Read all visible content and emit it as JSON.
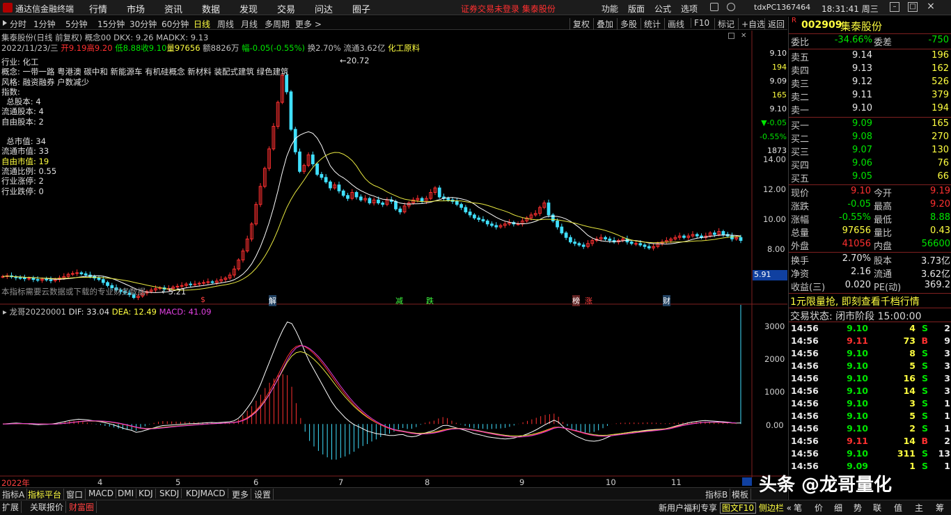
{
  "menubar": {
    "app_title": "通达信金融终端",
    "menus": [
      "行情",
      "市场",
      "资讯",
      "数据",
      "发现",
      "交易",
      "问达",
      "圈子"
    ],
    "warning": "证券交易未登录  集泰股份",
    "right_menus": [
      "功能",
      "版面",
      "公式",
      "选项"
    ],
    "account": "tdxPC1367464",
    "clock": "18:31:41 周三"
  },
  "periods": [
    "分时",
    "1分钟",
    "5分钟",
    "15分钟",
    "30分钟",
    "60分钟",
    "日线",
    "周线",
    "月线",
    "多周期",
    "更多 >"
  ],
  "active_period": "日线",
  "tools": [
    "复权",
    "叠加",
    "多股",
    "统计",
    "画线",
    "F10",
    "标记",
    "+自选",
    "返回"
  ],
  "main": {
    "header1": "集泰股份(日线 前复权) ",
    "header1b": "概念00 DKX: 9.26 MADKX: 9.13",
    "date_line": "2022/11/23/三",
    "open": "开9.19",
    "high": "高9.20",
    "low": "低8.88",
    "close": "收9.10",
    "vol": "量97656",
    "amt": "额8826万",
    "chg": "幅-0.05(-0.55%)",
    "turn": "换2.70%",
    "float": "流通3.62亿",
    "sector": "化工原料",
    "info_lines": [
      "行业: 化工",
      "概念: 一带一路 粤港澳 碳中和 新能源车 有机硅概念 新材料 装配式建筑 绿色建筑",
      "风格: 融资融券 户数减少",
      "指数:",
      "  总股本: 4",
      "流通股本: 4",
      "自由股本: 2",
      "",
      "  总市值: 34",
      "流通市值: 33",
      "自由市值: 19",
      "流通比例: 0.55",
      "行业涨停: 2",
      "行业跌停: 0"
    ],
    "note": "本指标需要云数据或下载的专业财务数据",
    "high_mark": "20.72",
    "low_mark": "5.21",
    "event_marks": [
      "$",
      "解",
      "减",
      "跌",
      "榜",
      "涨",
      "财"
    ],
    "axis_labels": [
      "14.00",
      "12.00",
      "10.00",
      "8.00"
    ],
    "mini_quote": [
      "9.10",
      "194",
      "9.09",
      "165",
      "9.10",
      "▼-0.05",
      "-0.55%",
      "1873"
    ],
    "cursor_label": "5.91"
  },
  "main_chart_data": {
    "type": "candlestick",
    "ylim": [
      5.0,
      21.5
    ],
    "x": [
      "2022-03-10",
      "2022-03-11",
      "2022-03-14",
      "2022-03-15",
      "2022-03-16",
      "2022-03-17",
      "2022-03-18",
      "2022-03-21",
      "2022-03-22",
      "2022-03-23",
      "2022-03-24",
      "2022-03-25",
      "2022-03-28",
      "2022-03-29",
      "2022-03-30",
      "2022-03-31",
      "2022-04-01",
      "2022-04-06",
      "2022-04-07",
      "2022-04-08",
      "2022-04-11",
      "2022-04-12",
      "2022-04-13",
      "2022-04-14",
      "2022-04-15",
      "2022-04-18",
      "2022-04-19",
      "2022-04-20",
      "2022-04-21",
      "2022-04-22",
      "2022-04-25",
      "2022-04-26",
      "2022-04-27",
      "2022-04-28",
      "2022-04-29",
      "2022-05-05",
      "2022-05-06",
      "2022-05-09",
      "2022-05-10",
      "2022-05-11",
      "2022-05-12",
      "2022-05-13",
      "2022-05-16",
      "2022-05-17",
      "2022-05-18",
      "2022-05-19",
      "2022-05-20",
      "2022-05-23",
      "2022-05-24",
      "2022-05-25",
      "2022-05-26",
      "2022-05-27",
      "2022-05-30",
      "2022-05-31",
      "2022-06-01",
      "2022-06-02",
      "2022-06-06",
      "2022-06-07",
      "2022-06-08",
      "2022-06-09",
      "2022-06-10",
      "2022-06-13",
      "2022-06-14",
      "2022-06-15",
      "2022-06-16",
      "2022-06-17",
      "2022-06-20",
      "2022-06-21",
      "2022-06-22",
      "2022-06-23",
      "2022-06-24",
      "2022-06-27",
      "2022-06-28",
      "2022-06-29",
      "2022-06-30",
      "2022-07-01",
      "2022-07-04",
      "2022-07-05",
      "2022-07-06",
      "2022-07-07",
      "2022-07-08",
      "2022-07-11",
      "2022-07-12",
      "2022-07-13",
      "2022-07-14",
      "2022-07-15",
      "2022-07-18",
      "2022-07-19",
      "2022-07-20",
      "2022-07-21",
      "2022-07-22",
      "2022-07-25",
      "2022-07-26",
      "2022-07-27",
      "2022-07-28",
      "2022-07-29",
      "2022-08-01",
      "2022-08-02",
      "2022-08-03",
      "2022-08-04",
      "2022-08-05",
      "2022-08-08",
      "2022-08-09",
      "2022-08-10",
      "2022-08-11",
      "2022-08-12",
      "2022-08-15",
      "2022-08-16",
      "2022-08-17",
      "2022-08-18",
      "2022-08-19",
      "2022-08-22",
      "2022-08-23",
      "2022-08-24",
      "2022-08-25",
      "2022-08-26",
      "2022-08-29",
      "2022-08-30",
      "2022-08-31",
      "2022-09-01",
      "2022-09-02",
      "2022-09-05",
      "2022-09-06",
      "2022-09-07",
      "2022-09-08",
      "2022-09-09",
      "2022-09-13",
      "2022-09-14",
      "2022-09-15",
      "2022-09-16",
      "2022-09-19",
      "2022-09-20",
      "2022-09-21",
      "2022-09-22",
      "2022-09-23",
      "2022-09-26",
      "2022-09-27",
      "2022-09-28",
      "2022-09-29",
      "2022-09-30",
      "2022-10-10",
      "2022-10-11",
      "2022-10-12",
      "2022-10-13",
      "2022-10-14",
      "2022-10-17",
      "2022-10-18",
      "2022-10-19",
      "2022-10-20",
      "2022-10-21",
      "2022-10-24",
      "2022-10-25",
      "2022-10-26",
      "2022-10-27",
      "2022-10-28",
      "2022-10-31",
      "2022-11-01",
      "2022-11-02",
      "2022-11-03",
      "2022-11-04",
      "2022-11-07",
      "2022-11-08",
      "2022-11-09",
      "2022-11-10",
      "2022-11-11",
      "2022-11-14",
      "2022-11-15",
      "2022-11-16",
      "2022-11-17",
      "2022-11-18",
      "2022-11-21",
      "2022-11-22",
      "2022-11-23"
    ],
    "closes": [
      6.7,
      6.75,
      6.68,
      6.62,
      6.6,
      6.55,
      6.58,
      6.5,
      6.45,
      6.52,
      6.48,
      6.42,
      6.5,
      6.6,
      6.7,
      6.85,
      6.9,
      6.95,
      6.88,
      6.8,
      6.7,
      6.6,
      6.5,
      6.3,
      6.1,
      5.95,
      5.8,
      5.7,
      5.6,
      5.5,
      5.3,
      5.4,
      5.6,
      5.7,
      5.8,
      5.9,
      5.95,
      5.85,
      5.9,
      6.0,
      6.05,
      6.1,
      6.2,
      6.15,
      6.2,
      6.25,
      6.3,
      6.35,
      6.3,
      6.4,
      6.5,
      6.6,
      6.8,
      7.2,
      7.8,
      8.4,
      9.2,
      10.2,
      11.5,
      12.7,
      13.9,
      15.2,
      16.7,
      18.3,
      20.1,
      19.0,
      16.5,
      15.0,
      13.7,
      14.1,
      14.8,
      14.2,
      13.5,
      13.3,
      13.0,
      12.6,
      12.8,
      12.4,
      12.1,
      11.9,
      12.3,
      12.0,
      11.8,
      11.9,
      11.6,
      11.8,
      11.6,
      11.5,
      11.8,
      11.7,
      11.2,
      11.0,
      11.4,
      11.6,
      11.8,
      11.9,
      11.7,
      11.9,
      12.3,
      12.6,
      12.0,
      11.9,
      11.8,
      11.7,
      11.5,
      11.3,
      11.0,
      10.8,
      10.6,
      10.5,
      10.4,
      10.2,
      10.1,
      10.0,
      10.1,
      10.2,
      10.3,
      10.2,
      10.2,
      10.4,
      10.6,
      10.8,
      10.9,
      11.3,
      11.6,
      10.8,
      10.4,
      10.0,
      9.6,
      9.3,
      9.0,
      8.9,
      8.8,
      8.7,
      8.9,
      9.1,
      9.2,
      9.3,
      9.2,
      9.1,
      9.0,
      9.1,
      9.2,
      9.0,
      8.9,
      8.9,
      8.8,
      8.7,
      8.6,
      8.7,
      8.9,
      9.0,
      9.1,
      9.2,
      9.3,
      9.4,
      9.3,
      9.4,
      9.5,
      9.4,
      9.3,
      9.4,
      9.6,
      9.5,
      9.7,
      9.5,
      9.4,
      9.2,
      9.3,
      9.1
    ]
  },
  "macd": {
    "header": "龙哥20220001 ",
    "dif": "DIF: 33.04",
    "dea": "DEA: 12.49",
    "macd": "MACD: 41.09",
    "axis_labels": [
      "3000",
      "2000",
      "1000",
      "0.00"
    ],
    "x_labels": [
      "2022年",
      "4",
      "5",
      "6",
      "7",
      "8",
      "9",
      "10",
      "11"
    ]
  },
  "macd_chart_data": {
    "type": "line",
    "ylim": [
      -1500,
      3300
    ],
    "dif": [
      0,
      10,
      20,
      30,
      20,
      10,
      0,
      -10,
      -20,
      -15,
      -10,
      0,
      20,
      50,
      80,
      110,
      130,
      150,
      140,
      130,
      110,
      90,
      70,
      40,
      10,
      -30,
      -80,
      -130,
      -170,
      -200,
      -260,
      -240,
      -200,
      -160,
      -120,
      -80,
      -50,
      -40,
      -30,
      -20,
      -10,
      0,
      10,
      15,
      20,
      30,
      40,
      50,
      40,
      50,
      60,
      70,
      100,
      180,
      320,
      500,
      700,
      950,
      1250,
      1600,
      1950,
      2300,
      2650,
      2950,
      3200,
      3150,
      2900,
      2600,
      2250,
      1950,
      1700,
      1450,
      1200,
      950,
      700,
      500,
      350,
      200,
      80,
      -20,
      -80,
      -150,
      -220,
      -260,
      -300,
      -320,
      -340,
      -360,
      -360,
      -340,
      -330,
      -380,
      -400,
      -380,
      -330,
      -280,
      -240,
      -200,
      -120,
      -50,
      -40,
      -80,
      -120,
      -160,
      -200,
      -250,
      -300,
      -330,
      -360,
      -400,
      -420,
      -440,
      -460,
      -470,
      -460,
      -440,
      -400,
      -360,
      -310,
      -250,
      -180,
      -100,
      -20,
      50,
      120,
      60,
      -80,
      -200,
      -300,
      -380,
      -440,
      -500,
      -530,
      -540,
      -520,
      -480,
      -420,
      -360,
      -330,
      -300,
      -280,
      -260,
      -240,
      -230,
      -210,
      -190,
      -180,
      -170,
      -160,
      -150,
      -120,
      -80,
      -40,
      0,
      30,
      60,
      80,
      100,
      110,
      100,
      90,
      80,
      70,
      60,
      40,
      30,
      33
    ],
    "dea": [
      0,
      3,
      8,
      13,
      15,
      14,
      11,
      7,
      2,
      -1,
      -3,
      -3,
      2,
      12,
      26,
      43,
      60,
      78,
      90,
      98,
      100,
      98,
      92,
      82,
      68,
      48,
      22,
      -8,
      -40,
      -72,
      -110,
      -136,
      -149,
      -151,
      -145,
      -132,
      -116,
      -101,
      -87,
      -74,
      -61,
      -49,
      -37,
      -27,
      -18,
      -8,
      2,
      12,
      17,
      24,
      31,
      39,
      51,
      77,
      125,
      200,
      300,
      430,
      594,
      795,
      1026,
      1281,
      1555,
      1834,
      2107,
      2316,
      2433,
      2466,
      2423,
      2329,
      2203,
      2052,
      1882,
      1696,
      1497,
      1298,
      1108,
      927,
      758,
      602,
      466,
      342,
      229,
      131,
      45,
      -28,
      -91,
      -145,
      -188,
      -218,
      -240,
      -268,
      -294,
      -311,
      -315,
      -308,
      -294,
      -275,
      -244,
      -205,
      -172,
      -154,
      -147,
      -150,
      -160,
      -178,
      -202,
      -227,
      -254,
      -283,
      -310,
      -336,
      -361,
      -383,
      -398,
      -407,
      -406,
      -398,
      -380,
      -354,
      -319,
      -275,
      -224,
      -170,
      -112,
      -102,
      -126,
      -156,
      -190,
      -225,
      -266,
      -306,
      -338,
      -364,
      -379,
      -386,
      -378,
      -362,
      -344,
      -327,
      -309,
      -291,
      -273,
      -258,
      -242,
      -226,
      -212,
      -198,
      -182,
      -165,
      -140,
      -104,
      -66,
      -35,
      -10,
      12,
      32,
      48,
      56,
      61,
      60,
      56,
      49,
      43,
      35,
      26
    ]
  },
  "quote": {
    "code": "002909",
    "name": "集泰股份",
    "weibi_l": "委比",
    "weibi": "-34.66%",
    "weicha_l": "委差",
    "weicha": "-750",
    "asks": [
      {
        "l": "卖五",
        "p": "9.14",
        "v": "196"
      },
      {
        "l": "卖四",
        "p": "9.13",
        "v": "162"
      },
      {
        "l": "卖三",
        "p": "9.12",
        "v": "526"
      },
      {
        "l": "卖二",
        "p": "9.11",
        "v": "379"
      },
      {
        "l": "卖一",
        "p": "9.10",
        "v": "194"
      }
    ],
    "bids": [
      {
        "l": "买一",
        "p": "9.09",
        "v": "165"
      },
      {
        "l": "买二",
        "p": "9.08",
        "v": "270"
      },
      {
        "l": "买三",
        "p": "9.07",
        "v": "130"
      },
      {
        "l": "买四",
        "p": "9.06",
        "v": "76"
      },
      {
        "l": "买五",
        "p": "9.05",
        "v": "66"
      }
    ],
    "stats": [
      {
        "l": "现价",
        "v": "9.10",
        "c": "red",
        "l2": "今开",
        "v2": "9.19",
        "c2": "red"
      },
      {
        "l": "涨跌",
        "v": "-0.05",
        "c": "green",
        "l2": "最高",
        "v2": "9.20",
        "c2": "red"
      },
      {
        "l": "涨幅",
        "v": "-0.55%",
        "c": "green",
        "l2": "最低",
        "v2": "8.88",
        "c2": "green"
      },
      {
        "l": "总量",
        "v": "97656",
        "c": "yel",
        "l2": "量比",
        "v2": "0.43",
        "c2": "yel"
      },
      {
        "l": "外盘",
        "v": "41056",
        "c": "red",
        "l2": "内盘",
        "v2": "56600",
        "c2": "green"
      }
    ],
    "stats2": [
      {
        "l": "换手",
        "v": "2.70%",
        "l2": "股本",
        "v2": "3.73亿"
      },
      {
        "l": "净资",
        "v": "2.16",
        "l2": "流通",
        "v2": "3.62亿"
      },
      {
        "l": "收益(三)",
        "v": "0.020",
        "l2": "PE(动)",
        "v2": "369.2"
      }
    ],
    "promo": "1元限量抢, 即刻查看千档行情",
    "status": "交易状态: 闭市阶段 15:00:00",
    "ticks": [
      {
        "t": "14:56",
        "p": "9.10",
        "v": "4",
        "s": "S",
        "n": "2"
      },
      {
        "t": "14:56",
        "p": "9.11",
        "v": "73",
        "s": "B",
        "n": "9"
      },
      {
        "t": "14:56",
        "p": "9.10",
        "v": "8",
        "s": "S",
        "n": "3"
      },
      {
        "t": "14:56",
        "p": "9.10",
        "v": "5",
        "s": "S",
        "n": "3"
      },
      {
        "t": "14:56",
        "p": "9.10",
        "v": "16",
        "s": "S",
        "n": "3"
      },
      {
        "t": "14:56",
        "p": "9.10",
        "v": "14",
        "s": "S",
        "n": "3"
      },
      {
        "t": "14:56",
        "p": "9.10",
        "v": "3",
        "s": "S",
        "n": "1"
      },
      {
        "t": "14:56",
        "p": "9.10",
        "v": "5",
        "s": "S",
        "n": "1"
      },
      {
        "t": "14:56",
        "p": "9.10",
        "v": "2",
        "s": "S",
        "n": "1"
      },
      {
        "t": "14:56",
        "p": "9.11",
        "v": "14",
        "s": "B",
        "n": "2"
      },
      {
        "t": "14:56",
        "p": "9.10",
        "v": "311",
        "s": "S",
        "n": "13"
      },
      {
        "t": "14:56",
        "p": "9.09",
        "v": "1",
        "s": "S",
        "n": "1"
      }
    ]
  },
  "bottom": {
    "tabs1": [
      "指标A",
      "指标平台",
      "窗口",
      "MACD",
      "DMI",
      "KDJ",
      "SKDJ",
      "KDJMACD",
      "更多",
      "设置"
    ],
    "tabs1_right": [
      "指标B",
      "模板"
    ],
    "tabs2": [
      "扩展",
      "关联报价",
      "财富圈"
    ],
    "promo2": "新用户福利专享 ",
    "promo2b": "图文F10",
    "promo2c": "侧边栏",
    "rbtns": [
      "笔",
      "价",
      "细",
      "势",
      "联",
      "值",
      "主",
      "筹"
    ]
  },
  "watermark": "头条 @龙哥量化"
}
